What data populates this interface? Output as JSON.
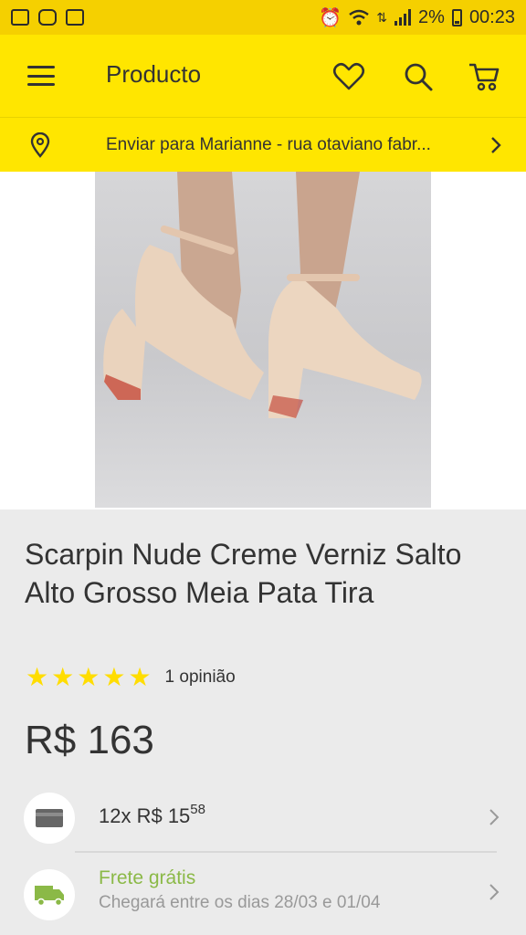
{
  "status_bar": {
    "battery_percent": "2%",
    "time": "00:23"
  },
  "header": {
    "title": "Producto",
    "icons": [
      "menu-icon",
      "heart-icon",
      "search-icon",
      "cart-icon"
    ]
  },
  "address": {
    "text": "Enviar para Marianne - rua otaviano fabr..."
  },
  "product": {
    "title": "Scarpin Nude Creme Verniz Salto Alto Grosso Meia Pata Tira",
    "rating_stars": 5,
    "reviews": "1 opinião",
    "price": "R$ 163"
  },
  "installment": {
    "prefix": "12x R$ 15",
    "cents": "58"
  },
  "shipping": {
    "title": "Frete grátis",
    "subtitle": "Chegará entre os dias 28/03 e 01/04"
  },
  "colors": {
    "brand_yellow": "#ffe600",
    "status_yellow": "#f5d000",
    "free_shipping_green": "#8bb947",
    "star": "#ffdd00"
  }
}
